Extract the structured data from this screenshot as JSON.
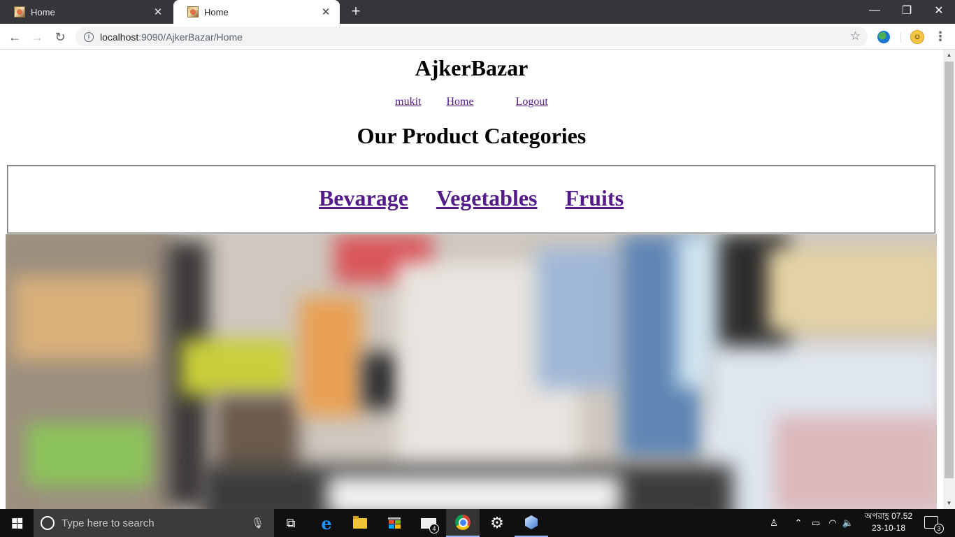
{
  "browser": {
    "tabs": [
      {
        "title": "Home",
        "active": false
      },
      {
        "title": "Home",
        "active": true
      }
    ],
    "url_host": "localhost",
    "url_path": ":9090/AjkerBazar/Home"
  },
  "page": {
    "site_title": "AjkerBazar",
    "nav": {
      "user": "mukit",
      "home": "Home",
      "logout": "Logout"
    },
    "section_heading": "Our Product Categories",
    "categories": [
      "Bevarage",
      "Vegetables",
      "Fruits"
    ]
  },
  "taskbar": {
    "search_placeholder": "Type here to search",
    "mail_badge": "4",
    "clock_time": "অপরাহ্ণ 07.52",
    "clock_date": "23-10-18",
    "notification_count": "3"
  },
  "colors": {
    "visited_link": "#551a8b",
    "tabstrip": "#35363a",
    "taskbar": "#101010"
  }
}
